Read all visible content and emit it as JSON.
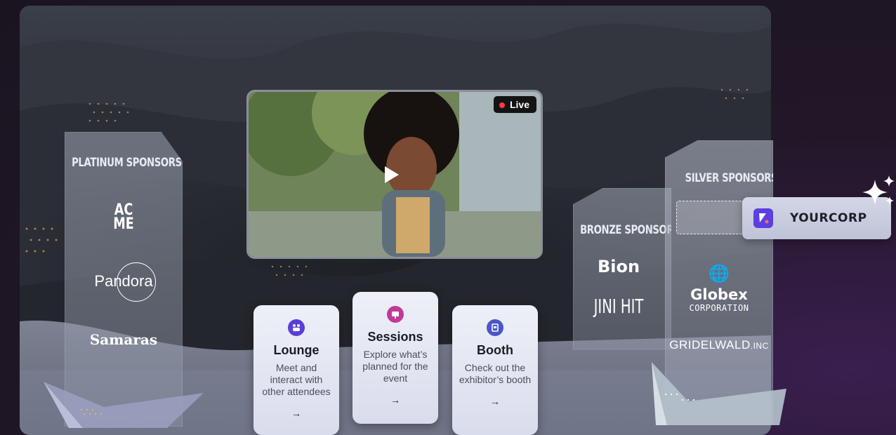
{
  "video": {
    "live_label": "Live"
  },
  "platinum": {
    "title": "PLATINUM SPONSORS",
    "logos": [
      "AC",
      "ME",
      "Pandora",
      "Samaras"
    ]
  },
  "bronze": {
    "title": "BRONZE SPONSORS",
    "logos": [
      "Bion",
      "JINI HIT"
    ]
  },
  "silver": {
    "title": "SILVER SPONSORS",
    "globex": "Globex",
    "globex_sub": "CORPORATION",
    "gridelwald": "GRIDELWALD",
    "gridelwald_suffix": ".INC"
  },
  "cards": [
    {
      "title": "Lounge",
      "desc": "Meet and interact with other attendees",
      "arrow": "→",
      "icon": "people-icon",
      "color": "#5a3fd6"
    },
    {
      "title": "Sessions",
      "desc": "Explore what’s planned for the event",
      "arrow": "→",
      "icon": "presentation-icon",
      "color": "#c2399a"
    },
    {
      "title": "Booth",
      "desc": "Check out the exhibitor’s booth",
      "arrow": "→",
      "icon": "booth-icon",
      "color": "#4b56c9"
    }
  ],
  "yourcorp": {
    "label": "YOURCORP"
  }
}
